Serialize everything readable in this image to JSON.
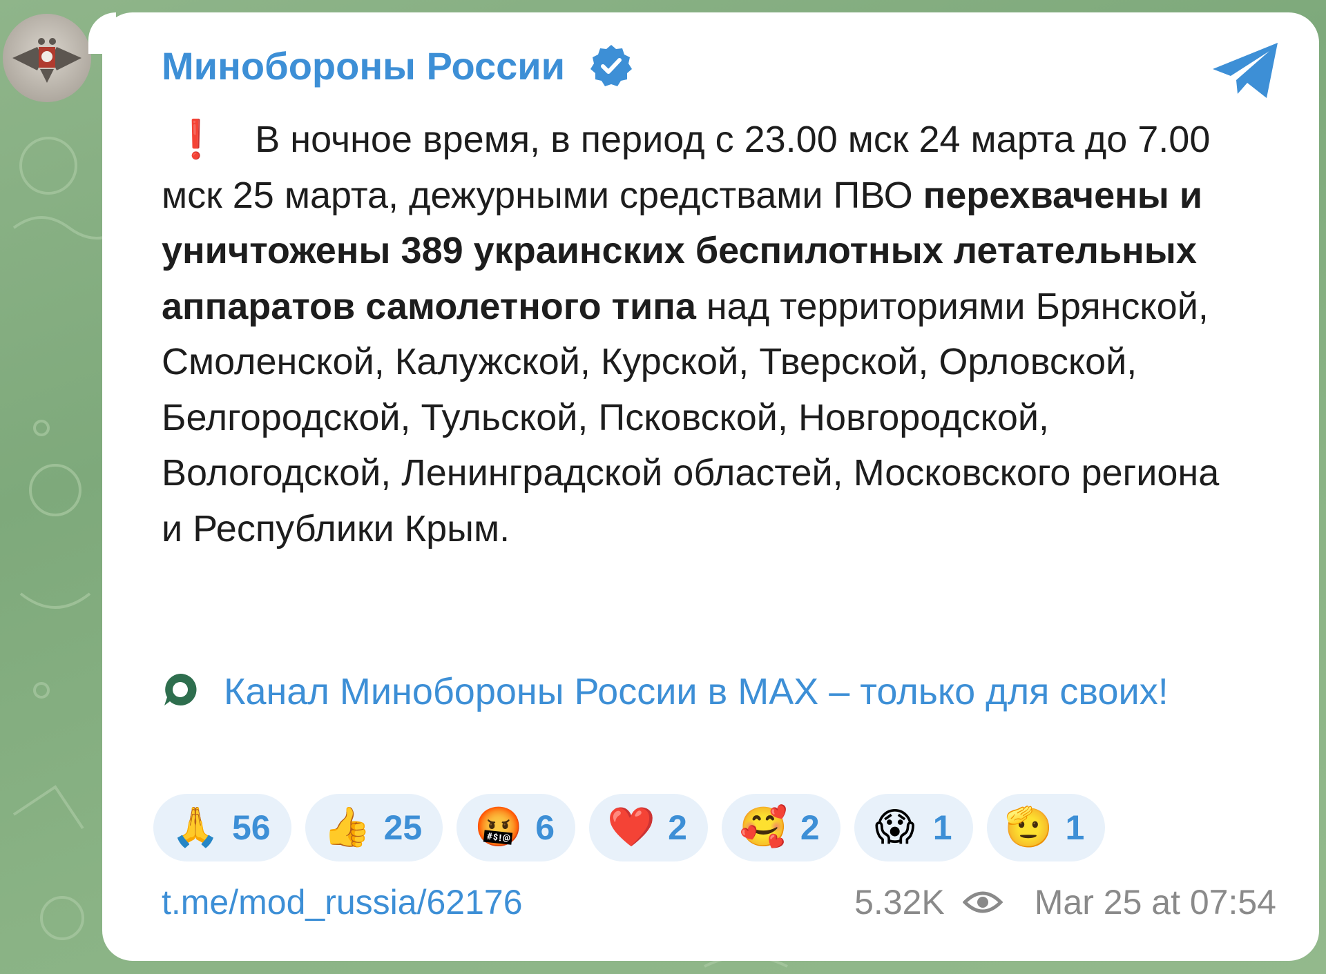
{
  "channel": {
    "name": "Минобороны России",
    "verified_icon": "verified-badge-icon",
    "share_icon": "telegram-share-icon"
  },
  "message": {
    "alert_glyph": "❗",
    "text_part1": "В ночное время, в период с 23.00 мск 24 марта до 7.00 мск 25 марта, дежурными средствами ПВО ",
    "text_bold": "перехвачены и уничтожены 389 украинских беспилотных летательных аппаратов самолетного типа",
    "text_part2": " над территориями Брянской, Смоленской, Калужской, Курской, Тверской, Орловской, Белгородской, Тульской, Псковской, Новгородской, Вологодской, Ленинградской областей, Московского региона и Республики Крым."
  },
  "promo": {
    "icon": "max-chat-icon",
    "text": "Канал Минобороны России в MAX – только для своих!"
  },
  "reactions": [
    {
      "emoji": "🙏",
      "count": "56"
    },
    {
      "emoji": "👍",
      "count": "25"
    },
    {
      "emoji": "🤬",
      "count": "6"
    },
    {
      "emoji": "❤️",
      "count": "2"
    },
    {
      "emoji": "🥰",
      "count": "2"
    },
    {
      "emoji": "😱",
      "count": "1"
    },
    {
      "emoji": "🫡",
      "count": "1"
    }
  ],
  "footer": {
    "link": "t.me/mod_russia/62176",
    "views": "5.32K",
    "views_icon": "eye-icon",
    "timestamp": "Mar 25 at 07:54"
  },
  "colors": {
    "accent": "#3d8fd6",
    "alert": "#e53935",
    "reaction_bg": "#e8f1fa",
    "chat_bg": "#8fb58a"
  }
}
